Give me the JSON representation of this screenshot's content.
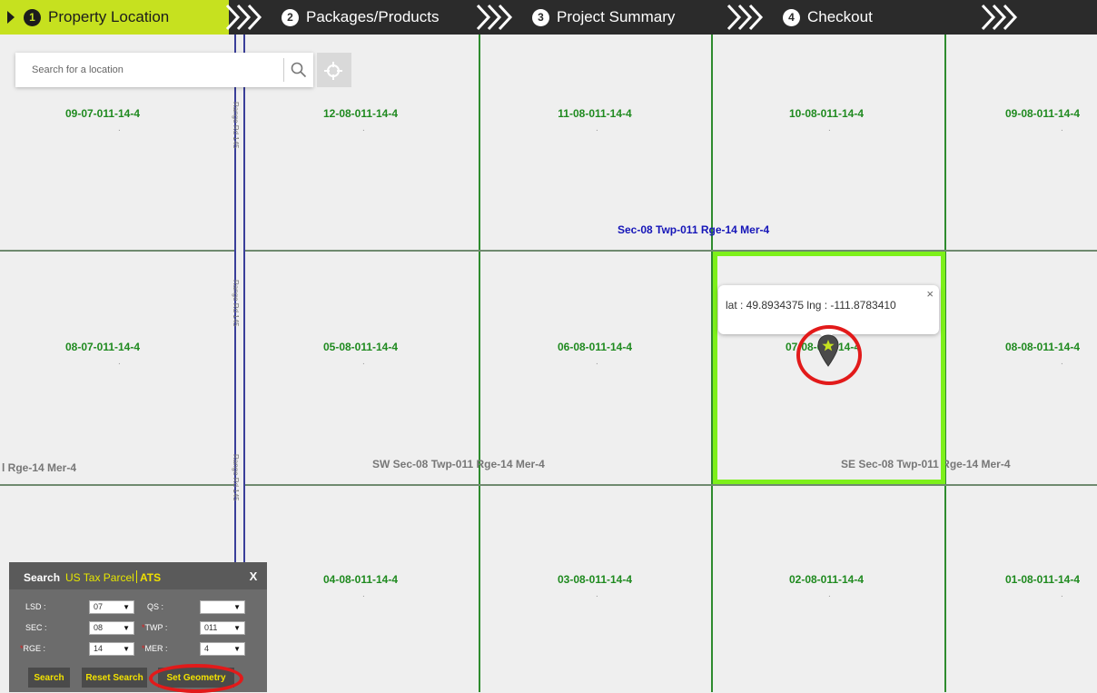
{
  "stepper": {
    "steps": [
      {
        "num": "1",
        "label": "Property Location"
      },
      {
        "num": "2",
        "label": "Packages/Products"
      },
      {
        "num": "3",
        "label": "Project Summary"
      },
      {
        "num": "4",
        "label": "Checkout"
      }
    ],
    "active_color": "#c6e11f",
    "bar_color": "#2b2b2b"
  },
  "search": {
    "placeholder": "Search for a location"
  },
  "map": {
    "cells": [
      "09-07-011-14-4",
      "12-08-011-14-4",
      "11-08-011-14-4",
      "10-08-011-14-4",
      "09-08-011-14-4",
      "08-07-011-14-4",
      "05-08-011-14-4",
      "06-08-011-14-4",
      "07-08-011-14-4",
      "08-08-011-14-4",
      "04-08-011-14-4",
      "03-08-011-14-4",
      "02-08-011-14-4",
      "01-08-011-14-4"
    ],
    "dot": ".",
    "road_label": "Range Rd 145",
    "section_label": "Sec-08 Twp-011 Rge-14 Mer-4",
    "quarter_left": "l Rge-14 Mer-4",
    "quarter_sw": "SW Sec-08 Twp-011 Rge-14 Mer-4",
    "quarter_se": "SE Sec-08 Twp-011 Rge-14 Mer-4",
    "selected_color": "#7df01a"
  },
  "popup": {
    "text": "lat : 49.8934375 lng : -111.8783410",
    "close": "×"
  },
  "panel": {
    "title": "Search",
    "tab_us": "US Tax Parcel",
    "tab_ats": "ATS",
    "close": "X",
    "lsd_label": "LSD :",
    "lsd_value": "07",
    "qs_label": "QS :",
    "qs_value": "",
    "sec_label": "SEC :",
    "sec_value": "08",
    "twp_label": "TWP :",
    "twp_value": "011",
    "rge_label": "RGE :",
    "rge_value": "14",
    "mer_label": "MER :",
    "mer_value": "4",
    "required_mark": "*",
    "search_button": "Search",
    "reset_button": "Reset Search",
    "geometry_button": "Set Geometry"
  }
}
